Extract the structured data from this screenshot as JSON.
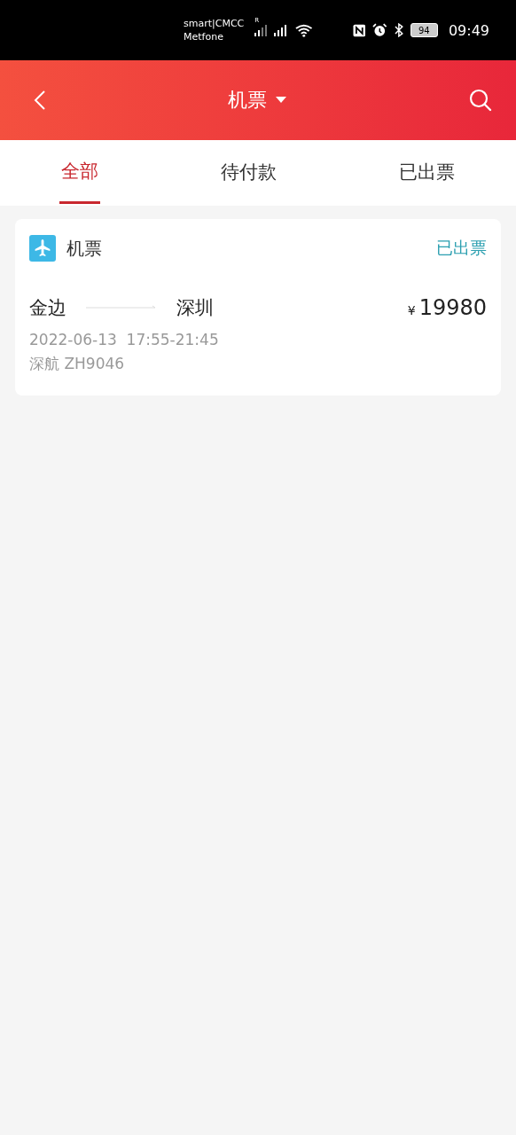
{
  "status_bar": {
    "carrier_lines": [
      "smart|CMCC",
      "Metfone"
    ],
    "roaming_mark": "R",
    "battery": "94",
    "time": "09:49"
  },
  "header": {
    "title": "机票"
  },
  "tabs": [
    {
      "label": "全部",
      "selected": true
    },
    {
      "label": "待付款",
      "selected": false
    },
    {
      "label": "已出票",
      "selected": false
    }
  ],
  "orders": [
    {
      "category": "机票",
      "status": "已出票",
      "from": "金边",
      "to": "深圳",
      "currency": "¥",
      "price": "19980",
      "datetime": "2022-06-13  17:55-21:45",
      "flight": "深航 ZH9046"
    }
  ]
}
